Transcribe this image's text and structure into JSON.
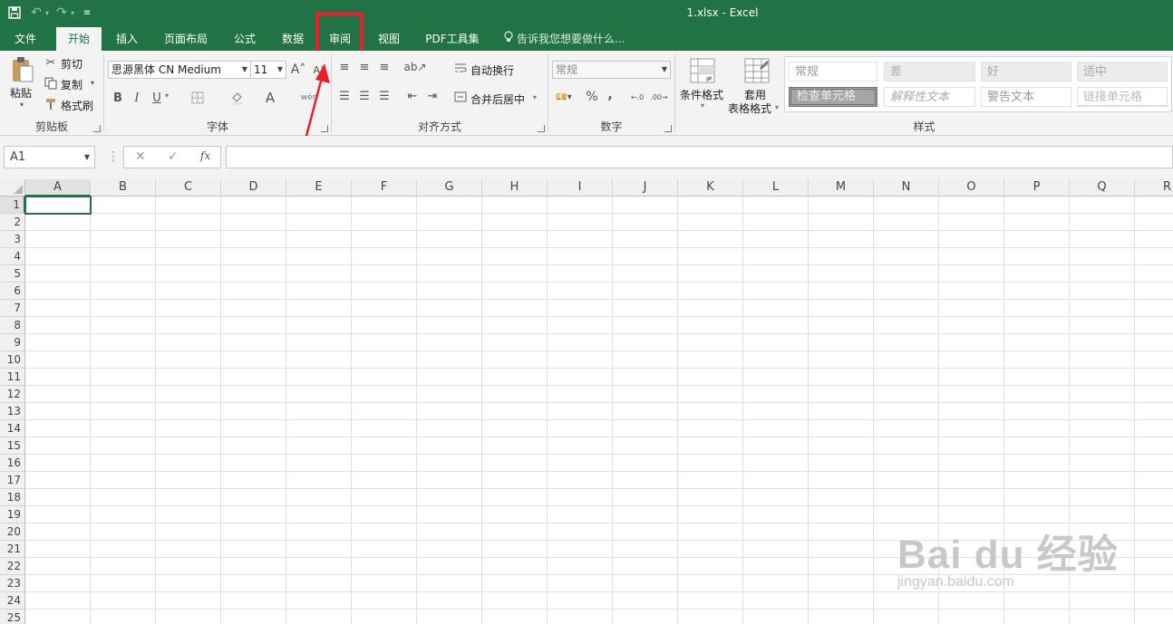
{
  "window": {
    "title": "1.xlsx - Excel"
  },
  "tabs": [
    {
      "label": "文件"
    },
    {
      "label": "开始"
    },
    {
      "label": "插入"
    },
    {
      "label": "页面布局"
    },
    {
      "label": "公式"
    },
    {
      "label": "数据"
    },
    {
      "label": "审阅"
    },
    {
      "label": "视图"
    },
    {
      "label": "PDF工具集"
    }
  ],
  "tellme": "告诉我您想要做什么...",
  "clipboard": {
    "paste": "粘贴",
    "cut": "剪切",
    "copy": "复制",
    "format_painter": "格式刷",
    "label": "剪贴板"
  },
  "font": {
    "name": "思源黑体 CN Medium",
    "size": "11",
    "label": "字体",
    "bold": "B",
    "italic": "I",
    "underline": "U"
  },
  "alignment": {
    "wrap": "自动换行",
    "merge": "合并后居中",
    "label": "对齐方式"
  },
  "number": {
    "format": "常规",
    "percent": "%",
    "comma": ",",
    "label": "数字"
  },
  "styles": {
    "conditional": "条件格式",
    "table_1": "套用",
    "table_2": "表格格式",
    "label": "样式",
    "cells": {
      "normal": "常规",
      "bad": "差",
      "good": "好",
      "neutral": "适中",
      "check": "检查单元格",
      "explanatory": "解释性文本",
      "warning": "警告文本",
      "linked": "链接单元格"
    }
  },
  "formula_bar": {
    "name_box": "A1",
    "fx": "fx",
    "value": ""
  },
  "columns": [
    "A",
    "B",
    "C",
    "D",
    "E",
    "F",
    "G",
    "H",
    "I",
    "J",
    "K",
    "L",
    "M",
    "N",
    "O",
    "P",
    "Q",
    "R"
  ],
  "rows": [
    "1",
    "2",
    "3",
    "4",
    "5",
    "6",
    "7",
    "8",
    "9",
    "10",
    "11",
    "12",
    "13",
    "14",
    "15",
    "16",
    "17",
    "18",
    "19",
    "20",
    "21",
    "22",
    "23",
    "24",
    "25"
  ],
  "watermark": {
    "logo": "Bai du 经验",
    "url": "jingyan.baidu.com"
  },
  "colors": {
    "accent": "#217346",
    "highlight": "#e8202a"
  }
}
